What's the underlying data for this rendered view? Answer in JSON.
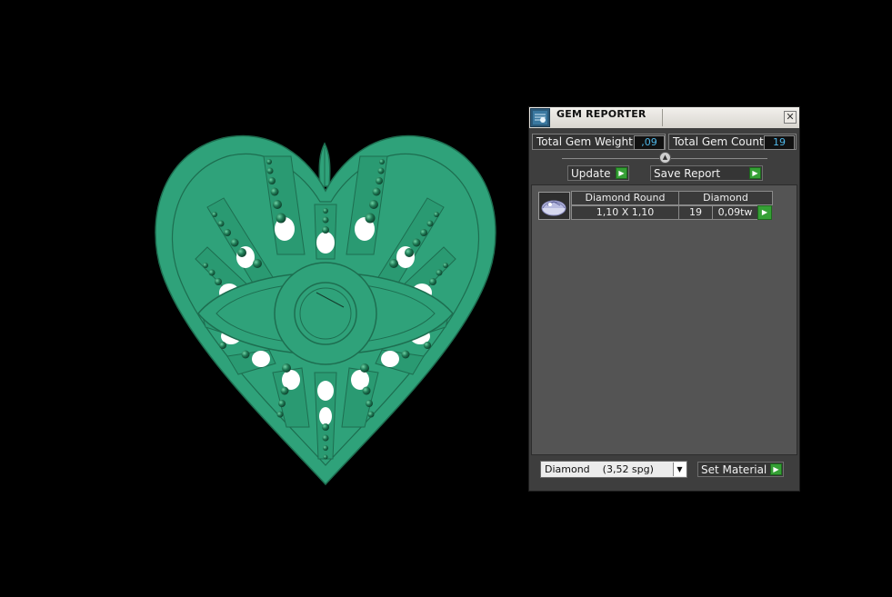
{
  "panel": {
    "title": "GEM REPORTER",
    "close_glyph": "✕",
    "total_gem_weight_label": "Total Gem Weight",
    "total_gem_weight_value": ",09",
    "total_gem_count_label": "Total Gem Count",
    "total_gem_count_value": "19",
    "update_label": "Update",
    "save_report_label": "Save Report",
    "set_material_label": "Set Material"
  },
  "gem_table": {
    "headers": [
      "Diamond Round",
      "Diamond"
    ],
    "rows": [
      {
        "size": "1,10 X 1,10",
        "count": "19",
        "weight": "0,09tw",
        "thumbnail": "round-gem-icon"
      }
    ]
  },
  "material_select": {
    "selected": "Diamond    (3,52 spg)"
  },
  "icons": {
    "title": "gem-reporter-icon",
    "close": "close-icon",
    "arrow": "play-arrow-icon",
    "dropdown": "chevron-down-icon",
    "slider": "slider-knob-icon"
  },
  "colors": {
    "model": "#2fa27a",
    "model_dark": "#1d6e50",
    "gem": "#1f7a55",
    "accent_value": "#4fb7e8",
    "arrow": "#35a035",
    "panel_bg": "#3e3e3e",
    "list_bg": "#545454"
  }
}
